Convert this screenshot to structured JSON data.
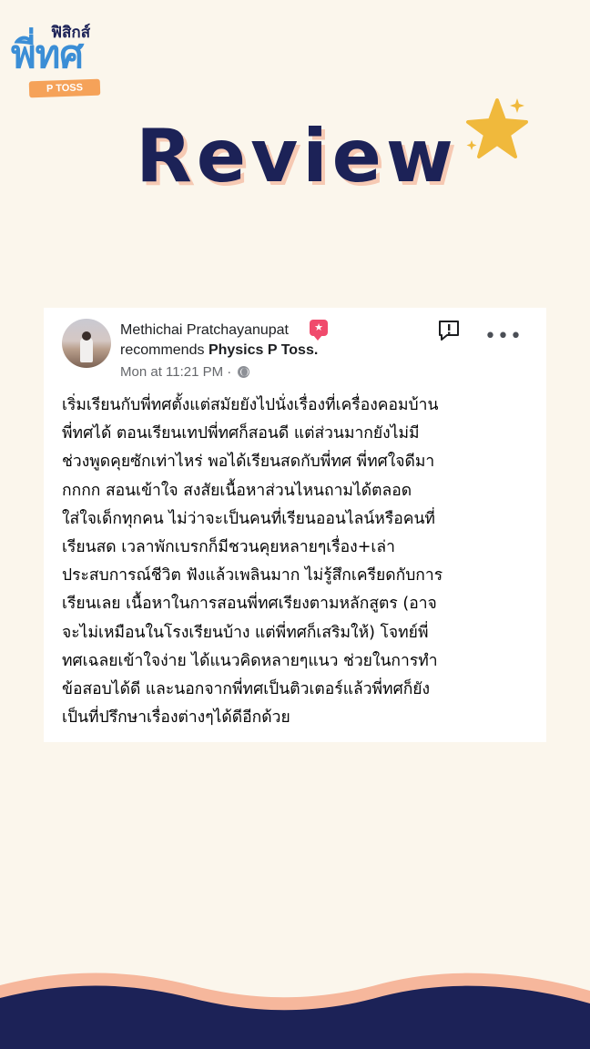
{
  "logo": {
    "top": "ฟิสิกส์",
    "main": "พี่ทศ",
    "badge": "P TOSS"
  },
  "heading": "Review",
  "review": {
    "author": "Methichai Pratchayanupat",
    "recommends_prefix": "recommends",
    "page_name": "Physics P Toss.",
    "timestamp": "Mon at 11:21 PM",
    "separator": "·",
    "icons": {
      "badge": "star-badge-icon",
      "report": "report-icon",
      "more": "more-options-icon",
      "privacy": "globe-icon"
    },
    "lines": [
      "เริ่มเรียนกับพี่ทศตั้งแต่สมัยยังไปนั่งเรื่องที่เครื่องคอมบ้าน",
      "พี่ทศได้ ตอนเรียนเทปพี่ทศก็สอนดี แต่ส่วนมากยังไม่มี",
      "ช่วงพูดคุยซักเท่าไหร่ พอได้เรียนสดกับพี่ทศ พี่ทศใจดีมา",
      "กกกก สอนเข้าใจ สงสัยเนื้อหาส่วนไหนถามได้ตลอด",
      "ใส่ใจเด็กทุกคน ไม่ว่าจะเป็นคนที่เรียนออนไลน์หรือคนที่",
      "เรียนสด เวลาพักเบรกก็มีชวนคุยหลายๆเรื่อง+เล่า",
      "ประสบการณ์ชีวิต ฟังแล้วเพลินมาก ไม่รู้สึกเครียดกับการ",
      "เรียนเลย เนื้อหาในการสอนพี่ทศเรียงตามหลักสูตร (อาจ",
      "จะไม่เหมือนในโรงเรียนบ้าง แต่พี่ทศก็เสริมให้) โจทย์พี่",
      "ทศเฉลยเข้าใจง่าย ได้แนวคิดหลายๆแนว ช่วยในการทำ",
      "ข้อสอบได้ดี และนอกจากพี่ทศเป็นติวเตอร์แล้วพี่ทศก็ยัง",
      "เป็นที่ปรึกษาเรื่องต่างๆได้ดีอีกด้วย"
    ]
  },
  "colors": {
    "background": "#fbf6ec",
    "navy": "#1c2257",
    "logo_blue": "#3b8ed6",
    "orange": "#f5a259",
    "peach": "#f6c9b3",
    "star": "#f0b93c"
  }
}
